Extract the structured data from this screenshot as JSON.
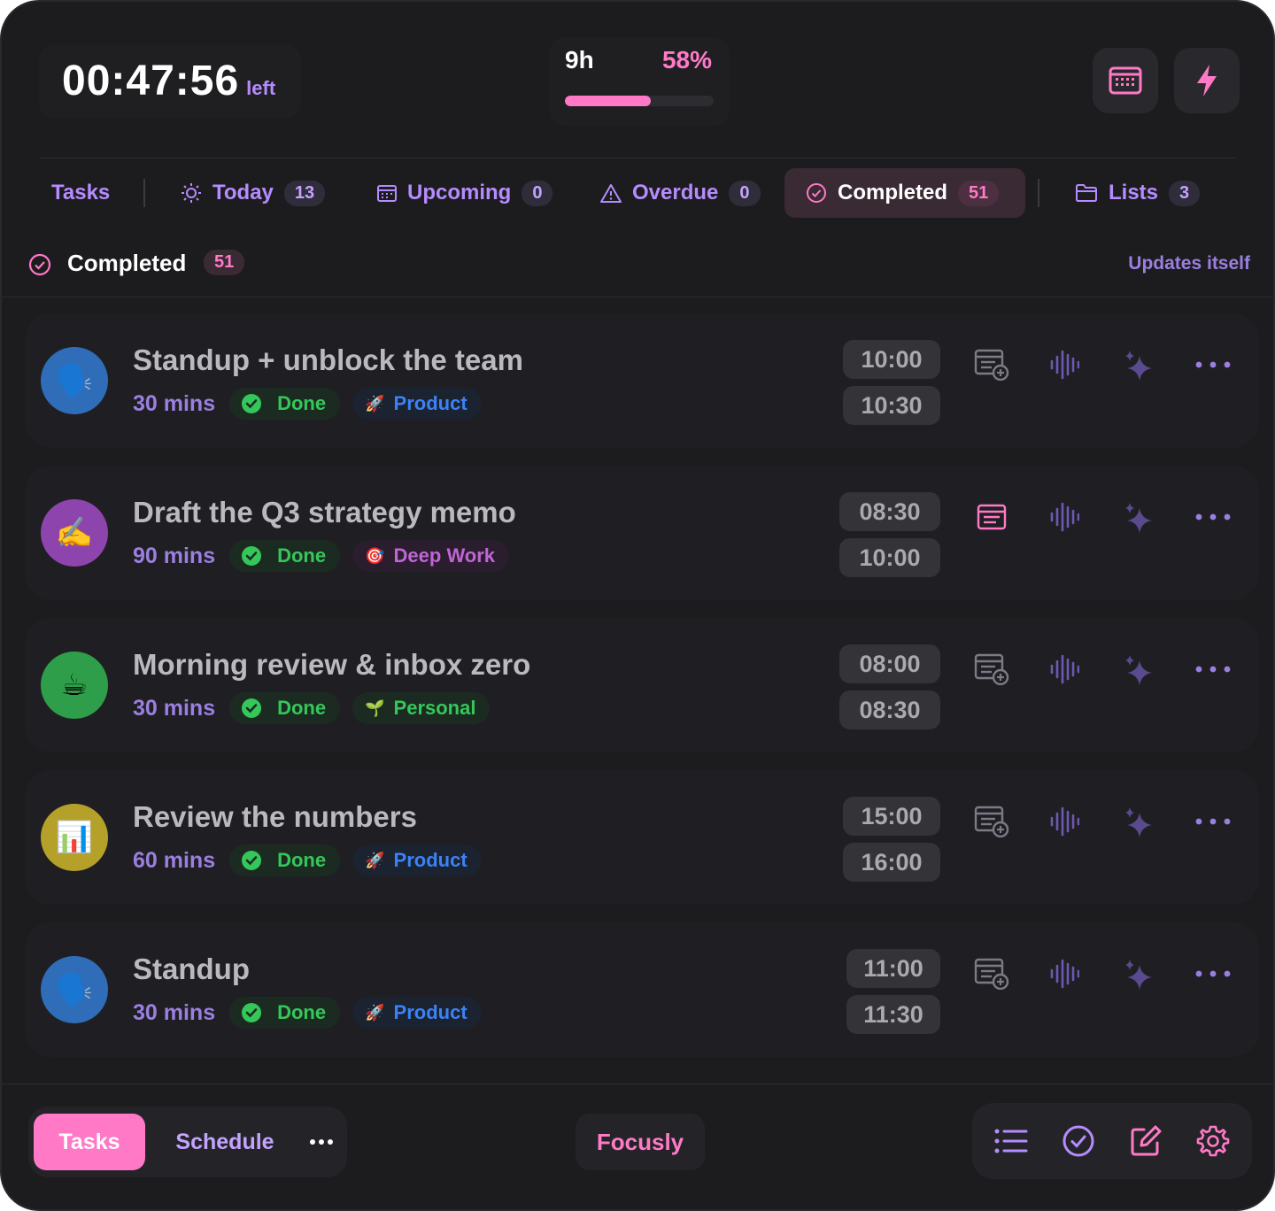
{
  "header": {
    "timer_value": "00:47:56",
    "timer_suffix": "left",
    "progress_hours": "9h",
    "progress_percent_label": "58%",
    "progress_fraction": 0.58
  },
  "tabs": [
    {
      "label": "Tasks",
      "count": ""
    },
    {
      "label": "Today",
      "count": "13"
    },
    {
      "label": "Upcoming",
      "count": "0"
    },
    {
      "label": "Overdue",
      "count": "0"
    },
    {
      "label": "Completed",
      "count": "51"
    },
    {
      "label": "Lists",
      "count": "3"
    }
  ],
  "section": {
    "title": "Completed",
    "count": "51",
    "updates_note": "Updates itself"
  },
  "tasks": [
    {
      "title": "Standup + unblock the team",
      "duration": "30 mins",
      "status": "Done",
      "tag": "Product",
      "tag_emoji": "🚀",
      "avatar_emoji": "🗣️",
      "start": "10:00",
      "end": "10:30"
    },
    {
      "title": "Draft the Q3 strategy memo",
      "duration": "90 mins",
      "status": "Done",
      "tag": "Deep Work",
      "tag_emoji": "🎯",
      "avatar_emoji": "✍️",
      "start": "08:30",
      "end": "10:00"
    },
    {
      "title": "Morning review & inbox zero",
      "duration": "30 mins",
      "status": "Done",
      "tag": "Personal",
      "tag_emoji": "🌱",
      "avatar_emoji": "☕",
      "start": "08:00",
      "end": "08:30"
    },
    {
      "title": "Review the numbers",
      "duration": "60 mins",
      "status": "Done",
      "tag": "Product",
      "tag_emoji": "🚀",
      "avatar_emoji": "📊",
      "start": "15:00",
      "end": "16:00"
    },
    {
      "title": "Standup",
      "duration": "30 mins",
      "status": "Done",
      "tag": "Product",
      "tag_emoji": "🚀",
      "avatar_emoji": "🗣️",
      "start": "11:00",
      "end": "11:30"
    }
  ],
  "bottom": {
    "tasks_label": "Tasks",
    "schedule_label": "Schedule",
    "brand": "Focusly"
  },
  "colors": {
    "accent_pink": "#ff79c6",
    "accent_purple": "#b58cff",
    "done_green": "#34c759",
    "product_blue": "#3b82f6",
    "deep_work_magenta": "#c065d6"
  }
}
